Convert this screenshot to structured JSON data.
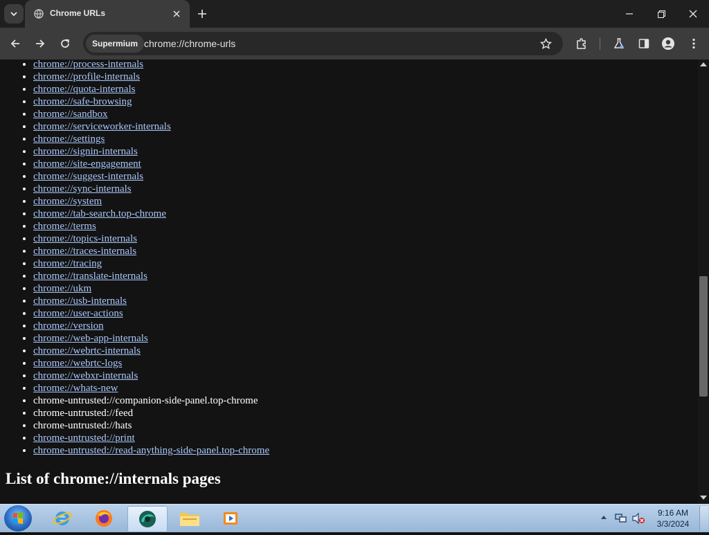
{
  "tab": {
    "title": "Chrome URLs"
  },
  "toolbar": {
    "chip_label": "Supermium",
    "url": "chrome://chrome-urls"
  },
  "links": [
    {
      "text": "chrome://process-internals",
      "is_link": true
    },
    {
      "text": "chrome://profile-internals",
      "is_link": true
    },
    {
      "text": "chrome://quota-internals",
      "is_link": true
    },
    {
      "text": "chrome://safe-browsing",
      "is_link": true
    },
    {
      "text": "chrome://sandbox",
      "is_link": true
    },
    {
      "text": "chrome://serviceworker-internals",
      "is_link": true
    },
    {
      "text": "chrome://settings",
      "is_link": true
    },
    {
      "text": "chrome://signin-internals",
      "is_link": true
    },
    {
      "text": "chrome://site-engagement",
      "is_link": true
    },
    {
      "text": "chrome://suggest-internals",
      "is_link": true
    },
    {
      "text": "chrome://sync-internals",
      "is_link": true
    },
    {
      "text": "chrome://system",
      "is_link": true
    },
    {
      "text": "chrome://tab-search.top-chrome",
      "is_link": true
    },
    {
      "text": "chrome://terms",
      "is_link": true
    },
    {
      "text": "chrome://topics-internals",
      "is_link": true
    },
    {
      "text": "chrome://traces-internals",
      "is_link": true
    },
    {
      "text": "chrome://tracing",
      "is_link": true
    },
    {
      "text": "chrome://translate-internals",
      "is_link": true
    },
    {
      "text": "chrome://ukm",
      "is_link": true
    },
    {
      "text": "chrome://usb-internals",
      "is_link": true
    },
    {
      "text": "chrome://user-actions",
      "is_link": true
    },
    {
      "text": "chrome://version",
      "is_link": true
    },
    {
      "text": "chrome://web-app-internals",
      "is_link": true
    },
    {
      "text": "chrome://webrtc-internals",
      "is_link": true
    },
    {
      "text": "chrome://webrtc-logs",
      "is_link": true
    },
    {
      "text": "chrome://webxr-internals",
      "is_link": true
    },
    {
      "text": "chrome://whats-new",
      "is_link": true
    },
    {
      "text": "chrome-untrusted://companion-side-panel.top-chrome",
      "is_link": false
    },
    {
      "text": "chrome-untrusted://feed",
      "is_link": false
    },
    {
      "text": "chrome-untrusted://hats",
      "is_link": false
    },
    {
      "text": "chrome-untrusted://print",
      "is_link": true
    },
    {
      "text": "chrome-untrusted://read-anything-side-panel.top-chrome",
      "is_link": true
    }
  ],
  "section_heading": "List of chrome://internals pages",
  "taskbar": {
    "apps": [
      "internet-explorer-icon",
      "firefox-icon",
      "supermium-icon",
      "file-explorer-icon",
      "media-player-icon"
    ],
    "time": "9:16 AM",
    "date": "3/3/2024"
  },
  "colors": {
    "link": "#a8c7fa",
    "page_bg": "#131313",
    "tab_bg": "#3c3c3c",
    "titlebar_bg": "#1f1f1f"
  }
}
